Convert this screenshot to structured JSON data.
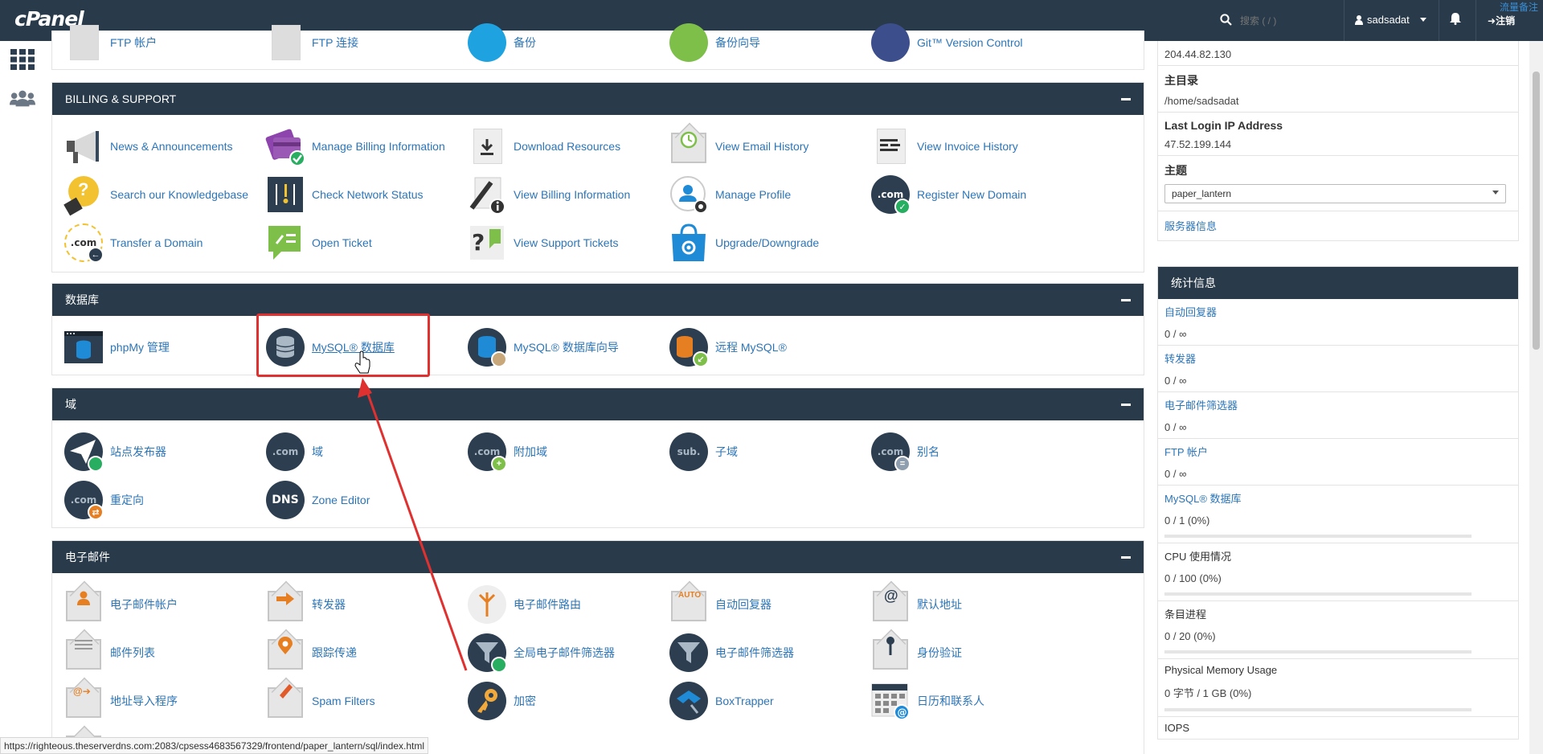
{
  "topbar": {
    "logo": "cPanel",
    "search_placeholder": "搜索 ( / )",
    "username": "sadsadat",
    "logout": "注销",
    "corner_link": "流量备注"
  },
  "rail": {
    "icons": [
      "grid-icon",
      "users-icon"
    ]
  },
  "top_partial_row": [
    "FTP 帐户",
    "FTP 连接",
    "备份",
    "备份向导",
    "Git™ Version Control"
  ],
  "billing": {
    "title": "BILLING & SUPPORT",
    "items": [
      "News & Announcements",
      "Manage Billing Information",
      "Download Resources",
      "View Email History",
      "View Invoice History",
      "Search our Knowledgebase",
      "Check Network Status",
      "View Billing Information",
      "Manage Profile",
      "Register New Domain",
      "Transfer a Domain",
      "Open Ticket",
      "View Support Tickets",
      "Upgrade/Downgrade"
    ]
  },
  "databases": {
    "title": "数据库",
    "items": [
      "phpMy 管理",
      "MySQL® 数据库",
      "MySQL® 数据库向导",
      "远程 MySQL®"
    ]
  },
  "domains": {
    "title": "域",
    "items": [
      "站点发布器",
      "域",
      "附加域",
      "子域",
      "别名",
      "重定向",
      "Zone Editor"
    ]
  },
  "email": {
    "title": "电子邮件",
    "items": [
      "电子邮件帐户",
      "转发器",
      "电子邮件路由",
      "自动回复器",
      "默认地址",
      "邮件列表",
      "跟踪传递",
      "全局电子邮件筛选器",
      "电子邮件筛选器",
      "身份验证",
      "地址导入程序",
      "Spam Filters",
      "加密",
      "BoxTrapper",
      "日历和联系人"
    ]
  },
  "icon_text": {
    "com": ".com",
    "sub": "sub.",
    "dns": "DNS",
    "auto": "AUTO",
    "at": "@"
  },
  "info": {
    "ip": "204.44.82.130",
    "home_label": "主目录",
    "home": "/home/sadsadat",
    "last_login_label": "Last Login IP Address",
    "last_login": "47.52.199.144",
    "theme_label": "主题",
    "theme": "paper_lantern",
    "server_info": "服务器信息"
  },
  "stats": {
    "title": "统计信息",
    "rows": [
      {
        "name": "自动回复器",
        "value": "0 / ∞"
      },
      {
        "name": "转发器",
        "value": "0 / ∞"
      },
      {
        "name": "电子邮件筛选器",
        "value": "0 / ∞"
      },
      {
        "name": "FTP 帐户",
        "value": "0 / ∞"
      },
      {
        "name": "MySQL® 数据库",
        "value": "0 / 1   (0%)",
        "percent": 0
      },
      {
        "name": "CPU 使用情况",
        "value": "0 / 100   (0%)",
        "percent": 0
      },
      {
        "name": "条目进程",
        "value": "0 / 20   (0%)",
        "percent": 0
      },
      {
        "name": "Physical Memory Usage",
        "value": "0 字节 / 1 GB   (0%)",
        "percent": 0
      },
      {
        "name": "IOPS"
      }
    ]
  },
  "status_url": "https://righteous.theserverdns.com:2083/cpsess4683567329/frontend/paper_lantern/sql/index.html",
  "colors": {
    "header": "#293a4a",
    "link": "#2c75b8",
    "highlight": "#e03131"
  }
}
